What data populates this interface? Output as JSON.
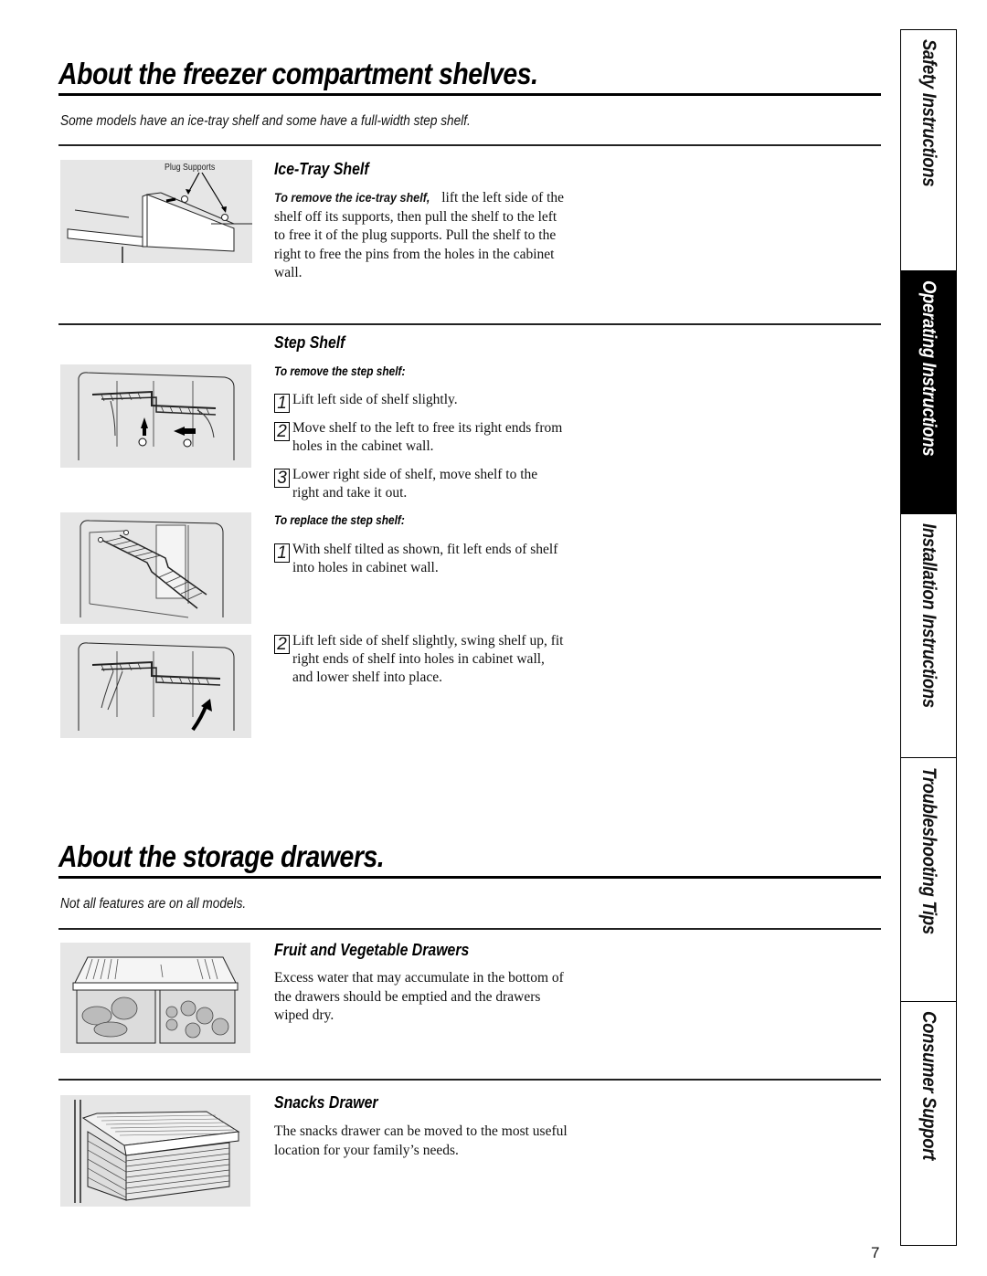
{
  "sections": {
    "freezer": {
      "title": "About the freezer compartment shelves.",
      "intro": "Some models have an ice-tray shelf and some have a full-width step shelf.",
      "ice_tray": {
        "heading": "Ice-Tray Shelf",
        "figure_label": "Plug Supports",
        "lead": "To remove the ice-tray shelf,",
        "text": " lift the left side of the shelf off its supports, then pull the shelf to the left to free it of the plug supports. Pull the shelf to the right to free the pins from the holes in the cabinet wall."
      },
      "step_shelf": {
        "heading": "Step Shelf",
        "remove_heading": "To remove the step shelf:",
        "remove_steps": [
          {
            "num": "1",
            "text": "Lift left side of shelf slightly."
          },
          {
            "num": "2",
            "text": "Move shelf to the left to free its right ends from holes in the cabinet wall."
          },
          {
            "num": "3",
            "text": "Lower right side of shelf, move shelf to the right and take it out."
          }
        ],
        "replace_heading": "To replace the step shelf:",
        "replace_steps": [
          {
            "num": "1",
            "text": "With shelf tilted as shown, fit left ends of shelf into holes in cabinet wall."
          },
          {
            "num": "2",
            "text": "Lift left side of shelf slightly, swing shelf up, fit right ends of shelf into holes in cabinet wall, and lower shelf into place."
          }
        ]
      }
    },
    "drawers": {
      "title": "About the storage drawers.",
      "intro": "Not all features are on all models.",
      "fruit_veg": {
        "heading": "Fruit and Vegetable Drawers",
        "text": "Excess water that may accumulate in the bottom of the drawers should be emptied and the drawers wiped dry."
      },
      "snacks": {
        "heading": "Snacks Drawer",
        "text": "The snacks drawer can be moved to the most useful location for your family’s needs."
      }
    }
  },
  "side_tabs": [
    {
      "label": "Safety Instructions",
      "active": false
    },
    {
      "label": "Operating Instructions",
      "active": true
    },
    {
      "label": "Installation Instructions",
      "active": false
    },
    {
      "label": "Troubleshooting Tips",
      "active": false
    },
    {
      "label": "Consumer Support",
      "active": false
    }
  ],
  "page_number": "7"
}
